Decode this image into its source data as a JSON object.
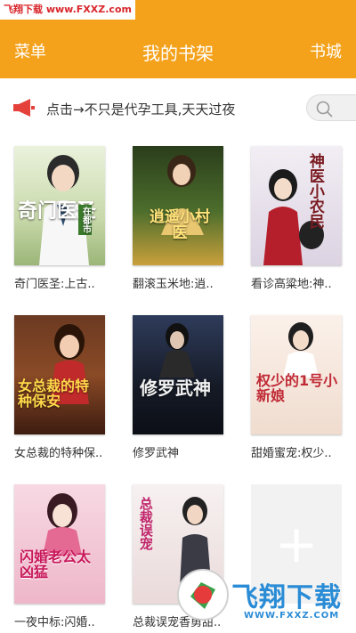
{
  "watermark_top": "飞翔下载 www.FXXZ.com",
  "header": {
    "left": "菜单",
    "title": "我的书架",
    "right": "书城"
  },
  "notice": {
    "text": "点击→不只是代孕工具,天天过夜"
  },
  "books": [
    {
      "title": "奇门医圣:上古..",
      "cover_title": "奇门医圣",
      "cover_subtitle": "在都市",
      "cover_color": "#cfe0b4"
    },
    {
      "title": "翻滚玉米地:逍..",
      "cover_title": "逍遥小村医",
      "cover_color": "#3a5a28"
    },
    {
      "title": "看诊高粱地:神..",
      "cover_title": "神医小农民",
      "cover_color": "#e9e4ec"
    },
    {
      "title": "女总裁的特种保..",
      "cover_title": "女总裁的特种保安",
      "cover_color": "#5a2a1a"
    },
    {
      "title": "修罗武神",
      "cover_title": "修罗武神",
      "cover_color": "#1e2230"
    },
    {
      "title": "甜婚蜜宠:权少..",
      "cover_title": "权少的1号小新娘",
      "cover_color": "#f6e6dc"
    },
    {
      "title": "一夜中标:闪婚..",
      "cover_title": "闪婚老公太凶猛",
      "cover_color": "#f1c9d6"
    },
    {
      "title": "总裁误宠香勇甜..",
      "cover_title": "总裁误宠",
      "cover_color": "#f3ecec"
    }
  ],
  "add_symbol": "+",
  "watermark_bottom": {
    "brand": "飞翔下载",
    "url": "WWW.FXXZ.COM"
  }
}
